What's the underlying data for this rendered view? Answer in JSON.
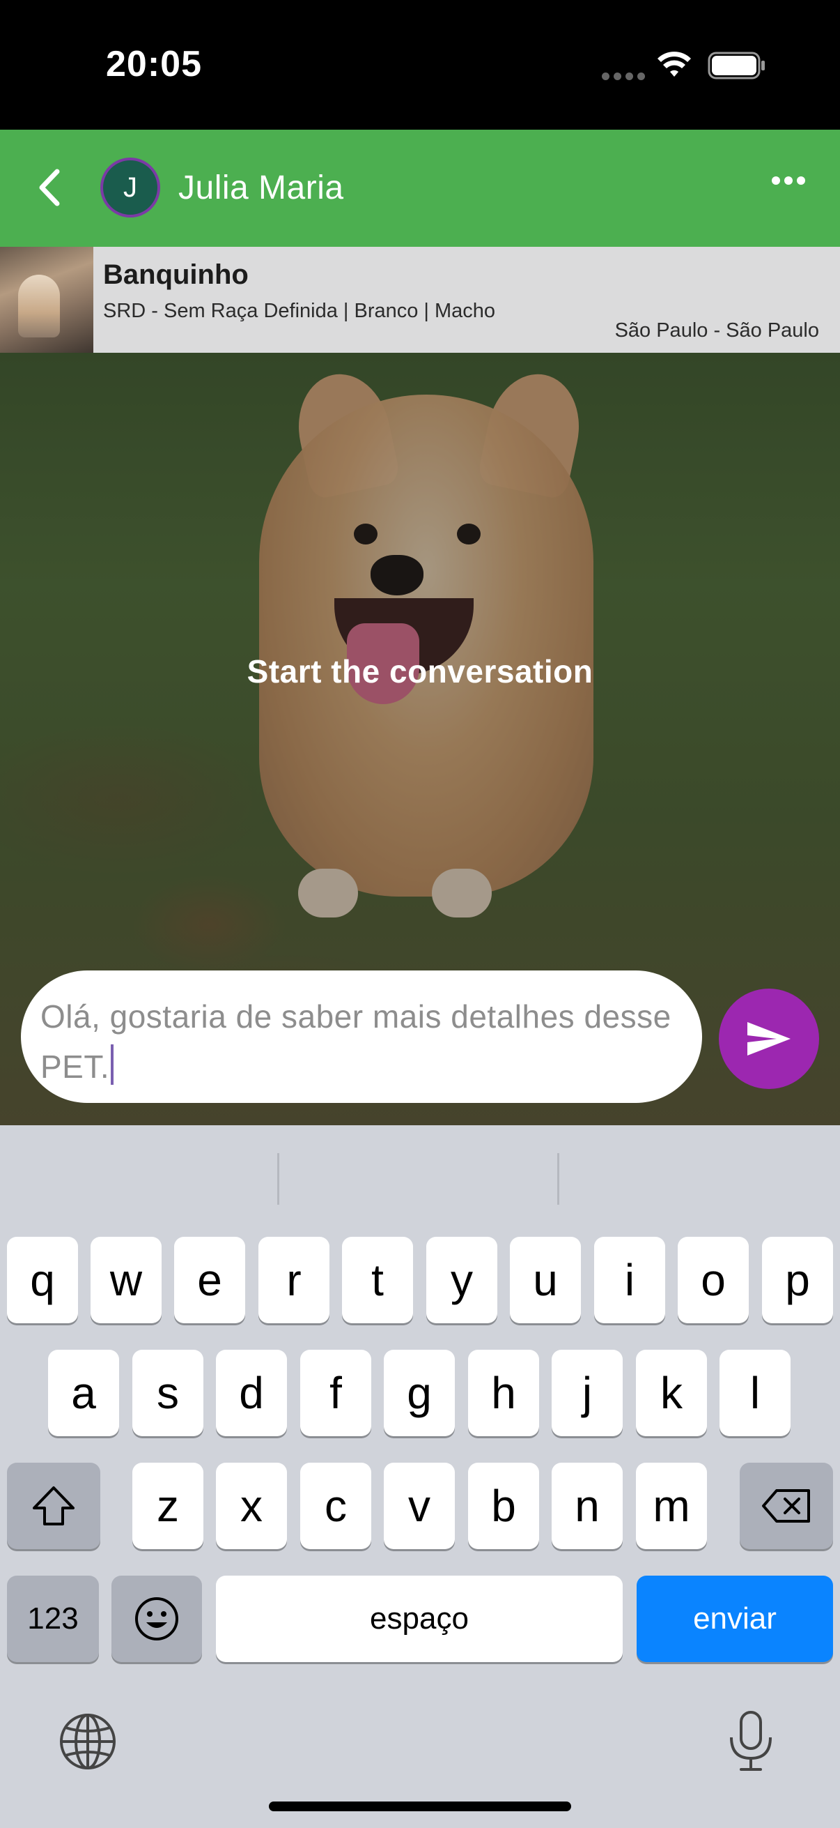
{
  "status_bar": {
    "time": "20:05"
  },
  "header": {
    "avatar_initial": "J",
    "contact_name": "Julia Maria",
    "accent_color": "#4caf50"
  },
  "pet": {
    "name": "Banquinho",
    "details": "SRD - Sem Raça Definida | Branco | Macho",
    "location": "São Paulo - São Paulo"
  },
  "chat": {
    "empty_hint": "Start the conversation"
  },
  "composer": {
    "message_text": "Olá, gostaria de saber mais detalhes desse PET.",
    "send_color": "#9c27b0"
  },
  "keyboard": {
    "row1": [
      "q",
      "w",
      "e",
      "r",
      "t",
      "y",
      "u",
      "i",
      "o",
      "p"
    ],
    "row2": [
      "a",
      "s",
      "d",
      "f",
      "g",
      "h",
      "j",
      "k",
      "l"
    ],
    "row3": [
      "z",
      "x",
      "c",
      "v",
      "b",
      "n",
      "m"
    ],
    "numbers_label": "123",
    "space_label": "espaço",
    "return_label": "enviar"
  }
}
